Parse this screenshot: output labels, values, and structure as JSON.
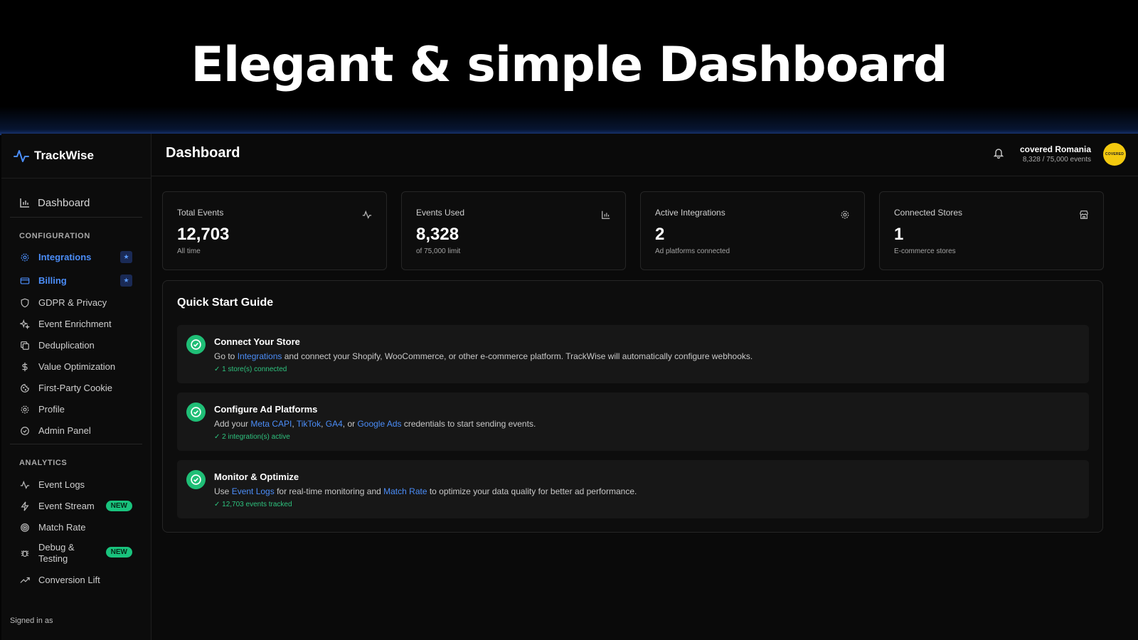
{
  "banner": {
    "title": "Elegant  & simple Dashboard"
  },
  "brand": {
    "name": "TrackWise"
  },
  "sidebar": {
    "dashboard_label": "Dashboard",
    "config_section": "CONFIGURATION",
    "config_items": [
      {
        "label": "Integrations",
        "icon": "gear-icon",
        "active": true,
        "badge": "★"
      },
      {
        "label": "Billing",
        "icon": "card-icon",
        "active": true,
        "badge": "★"
      },
      {
        "label": "GDPR & Privacy",
        "icon": "shield-icon"
      },
      {
        "label": "Event Enrichment",
        "icon": "sparkle-icon"
      },
      {
        "label": "Deduplication",
        "icon": "copy-icon"
      },
      {
        "label": "Value Optimization",
        "icon": "dollar-icon"
      },
      {
        "label": "First-Party Cookie",
        "icon": "cookie-icon"
      },
      {
        "label": "Profile",
        "icon": "gear-icon"
      },
      {
        "label": "Admin Panel",
        "icon": "check-circle-icon"
      }
    ],
    "analytics_section": "ANALYTICS",
    "analytics_items": [
      {
        "label": "Event Logs",
        "icon": "activity-icon"
      },
      {
        "label": "Event Stream",
        "icon": "bolt-icon",
        "badge": "NEW"
      },
      {
        "label": "Match Rate",
        "icon": "target-icon"
      },
      {
        "label": "Debug & Testing",
        "icon": "bug-icon",
        "badge": "NEW"
      },
      {
        "label": "Conversion Lift",
        "icon": "trend-icon"
      }
    ],
    "signed_in": "Signed in as"
  },
  "header": {
    "title": "Dashboard",
    "user_name": "covered Romania",
    "user_events": "8,328 / 75,000 events",
    "avatar_text": "COVERED"
  },
  "stats": [
    {
      "label": "Total Events",
      "value": "12,703",
      "sub": "All time",
      "icon": "activity-icon"
    },
    {
      "label": "Events Used",
      "value": "8,328",
      "sub": "of 75,000 limit",
      "icon": "bar-chart-icon"
    },
    {
      "label": "Active Integrations",
      "value": "2",
      "sub": "Ad platforms connected",
      "icon": "gear-icon"
    },
    {
      "label": "Connected Stores",
      "value": "1",
      "sub": "E-commerce stores",
      "icon": "store-icon"
    }
  ],
  "quick_start": {
    "title": "Quick Start Guide",
    "steps": [
      {
        "title": "Connect Your Store",
        "desc": [
          {
            "t": "Go to "
          },
          {
            "t": "Integrations",
            "link": true
          },
          {
            "t": " and connect your Shopify, WooCommerce, or other e-commerce platform. TrackWise will automatically configure webhooks."
          }
        ],
        "status": "✓ 1 store(s) connected"
      },
      {
        "title": "Configure Ad Platforms",
        "desc": [
          {
            "t": "Add your "
          },
          {
            "t": "Meta CAPI",
            "link": true
          },
          {
            "t": ", "
          },
          {
            "t": "TikTok",
            "link": true
          },
          {
            "t": ", "
          },
          {
            "t": "GA4",
            "link": true
          },
          {
            "t": ", or "
          },
          {
            "t": "Google Ads",
            "link": true
          },
          {
            "t": " credentials to start sending events."
          }
        ],
        "status": "✓ 2 integration(s) active"
      },
      {
        "title": "Monitor & Optimize",
        "desc": [
          {
            "t": "Use "
          },
          {
            "t": "Event Logs",
            "link": true
          },
          {
            "t": " for real-time monitoring and "
          },
          {
            "t": "Match Rate",
            "link": true
          },
          {
            "t": " to optimize your data quality for better ad performance."
          }
        ],
        "status": "✓ 12,703 events tracked"
      }
    ]
  },
  "colors": {
    "accent": "#4b8df8",
    "success": "#1fbe76",
    "badge_new": "#19c37d",
    "avatar": "#f3c90f"
  }
}
